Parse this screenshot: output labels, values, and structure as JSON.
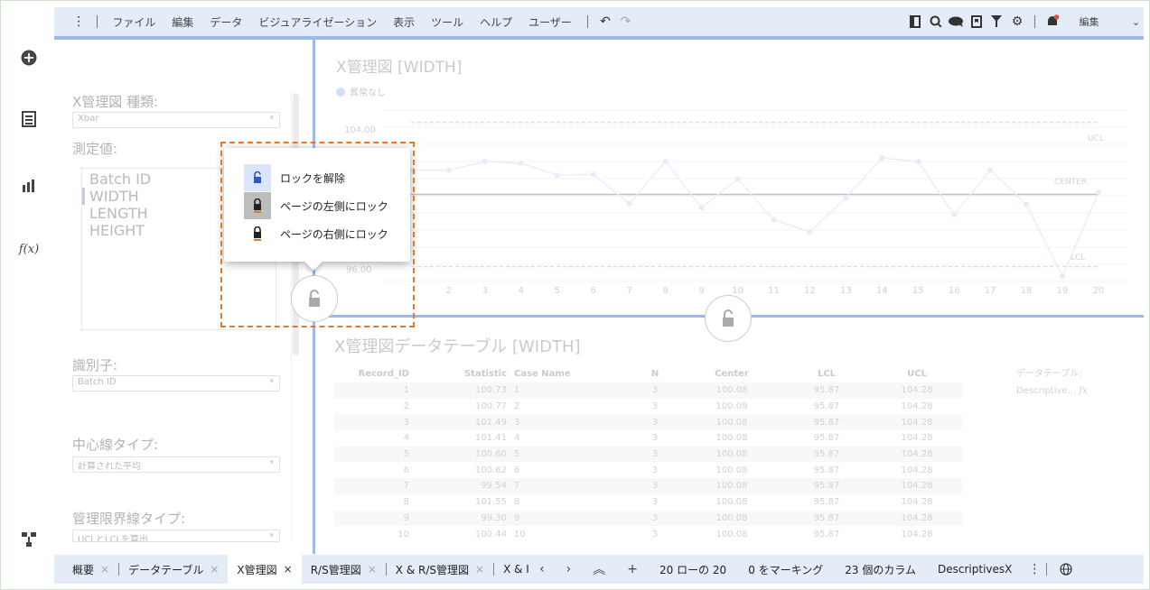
{
  "toolbar": {
    "menu": [
      "ファイル",
      "編集",
      "データ",
      "ビジュアライゼーション",
      "表示",
      "ツール",
      "ヘルプ",
      "ユーザー"
    ],
    "mode_label": "編集"
  },
  "panel": {
    "chart_type_label": "X管理図 種類:",
    "chart_type_value": "Xbar",
    "measure_label": "測定値:",
    "measures": [
      "Batch ID",
      "WIDTH",
      "LENGTH",
      "HEIGHT"
    ],
    "selected_measure": "WIDTH",
    "identifier_label": "識別子:",
    "identifier_value": "Batch ID",
    "center_line_label": "中心線タイプ:",
    "center_line_value": "計算された平均",
    "limit_label": "管理限界線タイプ:",
    "limit_value": "UCLとLCLを算出"
  },
  "chart": {
    "title": "X管理図 [WIDTH]",
    "legend": "異常なし",
    "ucl_label": "UCL",
    "center_label": "CENTER",
    "lcl_label": "LCL",
    "y_ticks": [
      "104.00",
      "96.00"
    ]
  },
  "chart_data": {
    "type": "line",
    "title": "X管理図 [WIDTH]",
    "x": [
      1,
      2,
      3,
      4,
      5,
      6,
      7,
      8,
      9,
      10,
      11,
      12,
      13,
      14,
      15,
      16,
      17,
      18,
      19,
      20
    ],
    "values": [
      101.49,
      101.49,
      102.0,
      101.9,
      101.2,
      101.25,
      99.54,
      102.0,
      99.3,
      100.98,
      98.6,
      97.9,
      99.9,
      102.2,
      102.0,
      98.9,
      101.5,
      99.5,
      95.3,
      100.2
    ],
    "center": 100.08,
    "ucl": 104.28,
    "lcl": 95.87,
    "ylim": [
      95.0,
      105.0
    ],
    "legend": [
      "異常なし"
    ]
  },
  "popup": {
    "items": [
      "ロックを解除",
      "ページの左側にロック",
      "ページの右側にロック"
    ]
  },
  "table": {
    "title": "X管理図データテーブル [WIDTH]",
    "headers": [
      "Record_ID",
      "Statistic",
      "Case Name",
      "N",
      "Center",
      "LCL",
      "UCL"
    ],
    "rows": [
      [
        "1",
        "100.73",
        "1",
        "3",
        "100.08",
        "95.87",
        "104.28"
      ],
      [
        "2",
        "100.77",
        "2",
        "3",
        "100.08",
        "95.87",
        "104.28"
      ],
      [
        "3",
        "101.49",
        "3",
        "3",
        "100.08",
        "95.87",
        "104.28"
      ],
      [
        "4",
        "101.41",
        "4",
        "3",
        "100.08",
        "95.87",
        "104.28"
      ],
      [
        "5",
        "100.60",
        "5",
        "3",
        "100.08",
        "95.87",
        "104.28"
      ],
      [
        "6",
        "100.62",
        "6",
        "3",
        "100.08",
        "95.87",
        "104.28"
      ],
      [
        "7",
        "99.54",
        "7",
        "3",
        "100.08",
        "95.87",
        "104.28"
      ],
      [
        "8",
        "101.55",
        "8",
        "3",
        "100.08",
        "95.87",
        "104.28"
      ],
      [
        "9",
        "99.30",
        "9",
        "3",
        "100.08",
        "95.87",
        "104.28"
      ],
      [
        "10",
        "100.44",
        "10",
        "3",
        "100.08",
        "95.87",
        "104.28"
      ]
    ],
    "side_label": "データテーブル:",
    "side_value": "Descriptive..."
  },
  "bottom": {
    "tabs": [
      "概要",
      "データテーブル",
      "X管理図",
      "R/S管理図",
      "X & R/S管理図",
      "X & I"
    ],
    "active_tab": "X管理図",
    "row_count": "20 ローの 20",
    "marking": "0 をマーキング",
    "columns": "23 個のカラム",
    "dataset": "DescriptivesX"
  },
  "colors": {
    "accent": "#9db8ee",
    "highlight": "#e07b28",
    "limit_line": "#f4a0a0"
  }
}
